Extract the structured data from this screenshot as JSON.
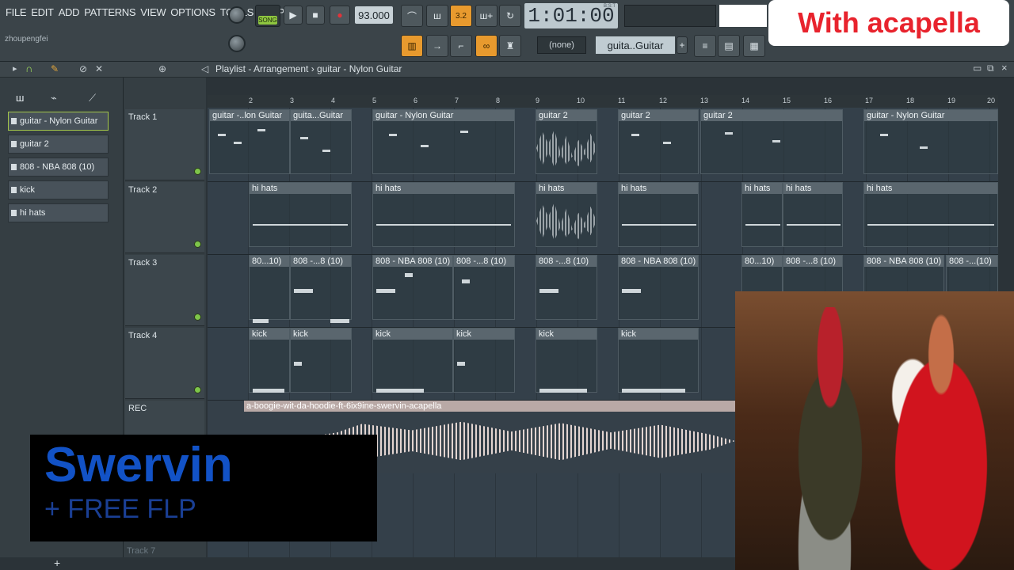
{
  "menu": [
    "FILE",
    "EDIT",
    "ADD",
    "PATTERNS",
    "VIEW",
    "OPTIONS",
    "TOOLS",
    "HELP"
  ],
  "user": "zhoupengfei",
  "song_label": "SONG",
  "tempo": "93.000",
  "time": "1:01:00",
  "time_unit": "B:S:T",
  "overlay_title": "With acapella",
  "pattern_selector": "(none)",
  "channel_selector": "guita..Guitar",
  "breadcrumb": "Playlist - Arrangement › guitar - Nylon Guitar",
  "picker": [
    "guitar - Nylon Guitar",
    "guitar 2",
    "808 - NBA 808 (10)",
    "kick",
    "hi hats"
  ],
  "tracks": [
    "Track 1",
    "Track 2",
    "Track 3",
    "Track 4"
  ],
  "rec_track": "REC",
  "track7": "Track 7",
  "ruler": [
    "2",
    "3",
    "4",
    "5",
    "6",
    "7",
    "8",
    "9",
    "10",
    "11",
    "12",
    "13",
    "14",
    "15",
    "16",
    "17",
    "18",
    "19",
    "20"
  ],
  "rec_clip": "a-boogie-wit-da-hoodie-ft-6ix9ine-swervin-acapella",
  "clips": {
    "t1": [
      "guitar -..lon Guitar",
      "guita...Guitar",
      "guitar - Nylon Guitar",
      "guitar 2",
      "guitar 2",
      "guitar 2",
      "guitar - Nylon Guitar"
    ],
    "t2": [
      "hi hats",
      "hi hats",
      "hi hats",
      "hi hats",
      "hi hats",
      "hi hats",
      "hi hats"
    ],
    "t3": [
      "80...10)",
      "808 -...8 (10)",
      "808 - NBA 808 (10)",
      "808 -...8 (10)",
      "808 -...8 (10)",
      "808 - NBA 808 (10)",
      "80...10)",
      "808 -...8 (10)",
      "808 - NBA 808 (10)",
      "808 -...(10)"
    ],
    "t4": [
      "kick",
      "kick",
      "kick",
      "kick",
      "kick",
      "kick"
    ]
  },
  "swervin": "Swervin",
  "flp": "+ FREE FLP",
  "add": "+"
}
